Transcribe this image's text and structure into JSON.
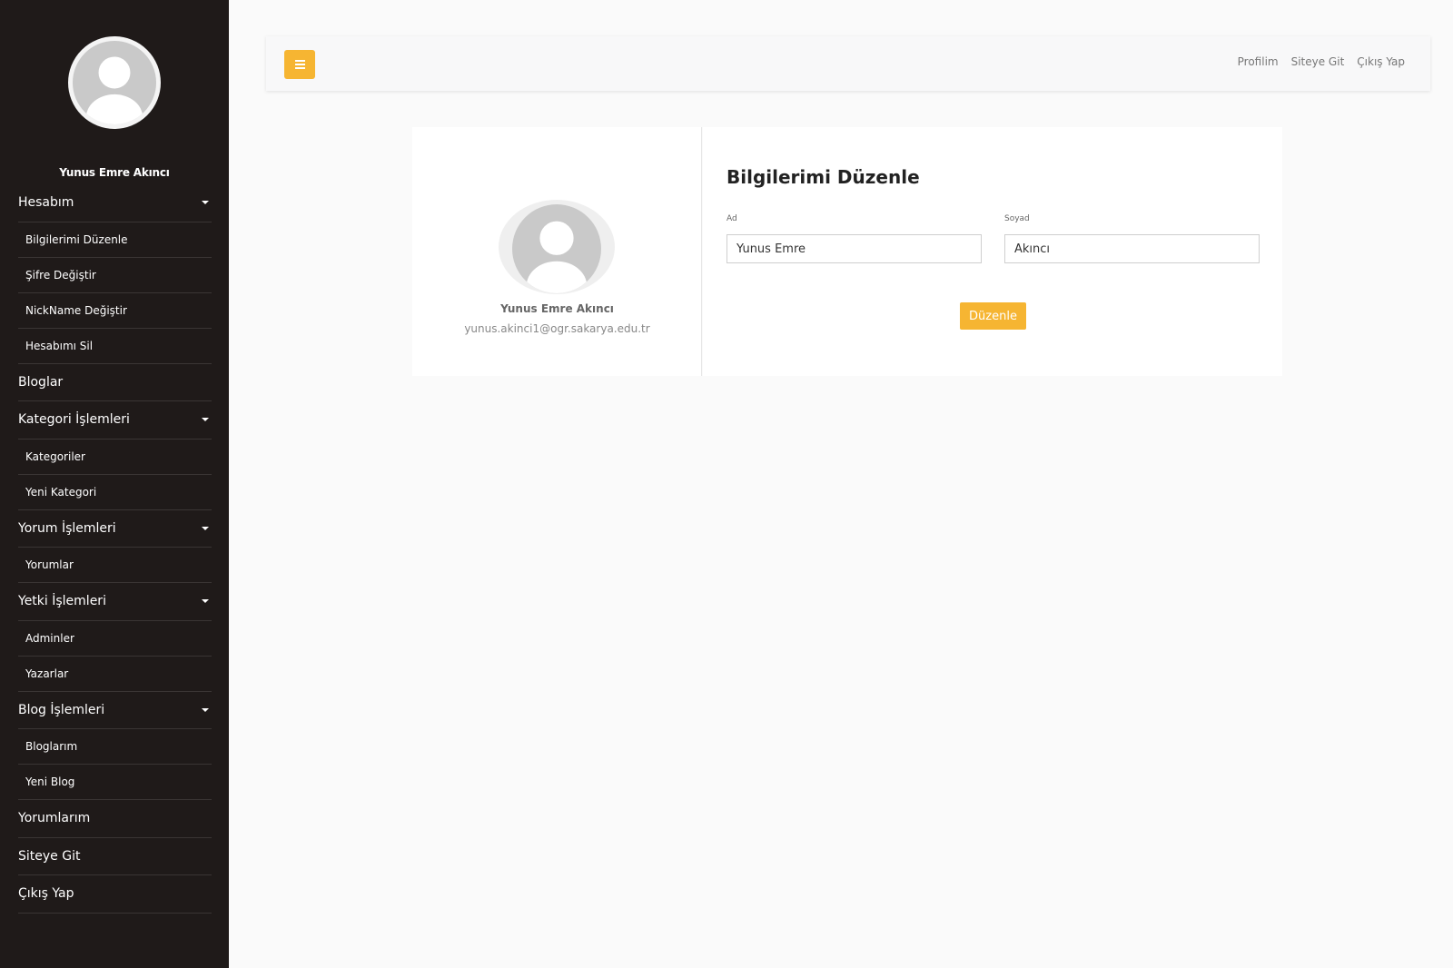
{
  "sidebar": {
    "user_name": "Yunus Emre Akıncı",
    "menu": [
      {
        "label": "Hesabım",
        "type": "top",
        "has_caret": true
      },
      {
        "label": "Bilgilerimi Düzenle",
        "type": "sub"
      },
      {
        "label": "Şifre Değiştir",
        "type": "sub"
      },
      {
        "label": "NickName Değiştir",
        "type": "sub"
      },
      {
        "label": "Hesabımı Sil",
        "type": "sub"
      },
      {
        "label": "Bloglar",
        "type": "top",
        "has_caret": false
      },
      {
        "label": "Kategori İşlemleri",
        "type": "top",
        "has_caret": true
      },
      {
        "label": "Kategoriler",
        "type": "sub"
      },
      {
        "label": "Yeni Kategori",
        "type": "sub"
      },
      {
        "label": "Yorum İşlemleri",
        "type": "top",
        "has_caret": true
      },
      {
        "label": "Yorumlar",
        "type": "sub"
      },
      {
        "label": "Yetki İşlemleri",
        "type": "top",
        "has_caret": true
      },
      {
        "label": "Adminler",
        "type": "sub"
      },
      {
        "label": "Yazarlar",
        "type": "sub"
      },
      {
        "label": "Blog İşlemleri",
        "type": "top",
        "has_caret": true
      },
      {
        "label": "Bloglarım",
        "type": "sub"
      },
      {
        "label": "Yeni Blog",
        "type": "sub"
      },
      {
        "label": "Yorumlarım",
        "type": "top",
        "has_caret": false
      },
      {
        "label": "Siteye Git",
        "type": "top",
        "has_caret": false
      },
      {
        "label": "Çıkış Yap",
        "type": "top",
        "has_caret": false
      }
    ]
  },
  "topbar": {
    "links": [
      "Profilim",
      "Siteye Git",
      "Çıkış Yap"
    ],
    "toggle_icon": "hamburger-icon"
  },
  "profile": {
    "name": "Yunus Emre Akıncı",
    "email": "yunus.akinci1@ogr.sakarya.edu.tr"
  },
  "form": {
    "title": "Bilgilerimi Düzenle",
    "first_name_label": "Ad",
    "first_name_value": "Yunus Emre",
    "last_name_label": "Soyad",
    "last_name_value": "Akıncı",
    "submit_label": "Düzenle"
  },
  "colors": {
    "accent": "#f6b532",
    "sidebar_bg": "#1f1a19",
    "page_bg": "#fafafa"
  }
}
